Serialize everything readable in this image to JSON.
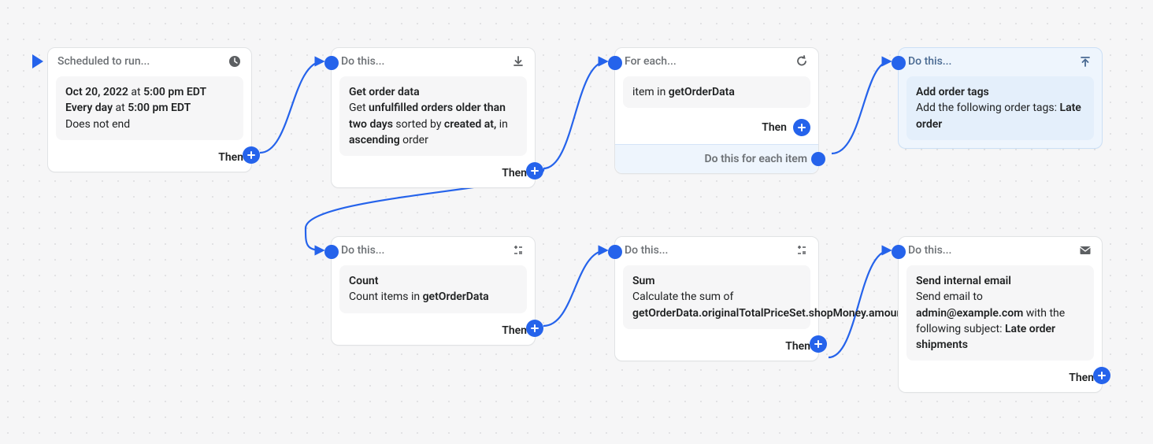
{
  "labels": {
    "then": "Then",
    "doThis": "Do this...",
    "scheduled": "Scheduled to run...",
    "forEach": "For each...",
    "doThisForEach": "Do this for each item"
  },
  "schedule": {
    "date": "Oct 20, 2022",
    "at": "at",
    "time": "5:00 pm EDT",
    "repeat_prefix": "Every day",
    "repeat_time": "5:00 pm EDT",
    "end": "Does not end"
  },
  "getOrder": {
    "title": "Get order data",
    "p1a": "Get ",
    "p1b": "unfulfilled orders older than two days",
    "p1c": " sorted by ",
    "p1d": "created at,",
    "p1e": " in ",
    "p1f": "ascending",
    "p1g": " order"
  },
  "forEach": {
    "prefix": "item in ",
    "var": "getOrderData"
  },
  "addTags": {
    "title": "Add order tags",
    "p1": "Add the following order tags: ",
    "p2": "Late order"
  },
  "count": {
    "title": "Count",
    "p1": "Count items in ",
    "var": "getOrderData"
  },
  "sum": {
    "title": "Sum",
    "p1": "Calculate the sum of ",
    "var": "getOrderData.originalTotalPriceSet.shopMoney.amount"
  },
  "email": {
    "title": "Send internal email",
    "p1": "Send email to ",
    "addr": "admin@example.com",
    "p2": " with the following subject: ",
    "subj": "Late order shipments"
  }
}
